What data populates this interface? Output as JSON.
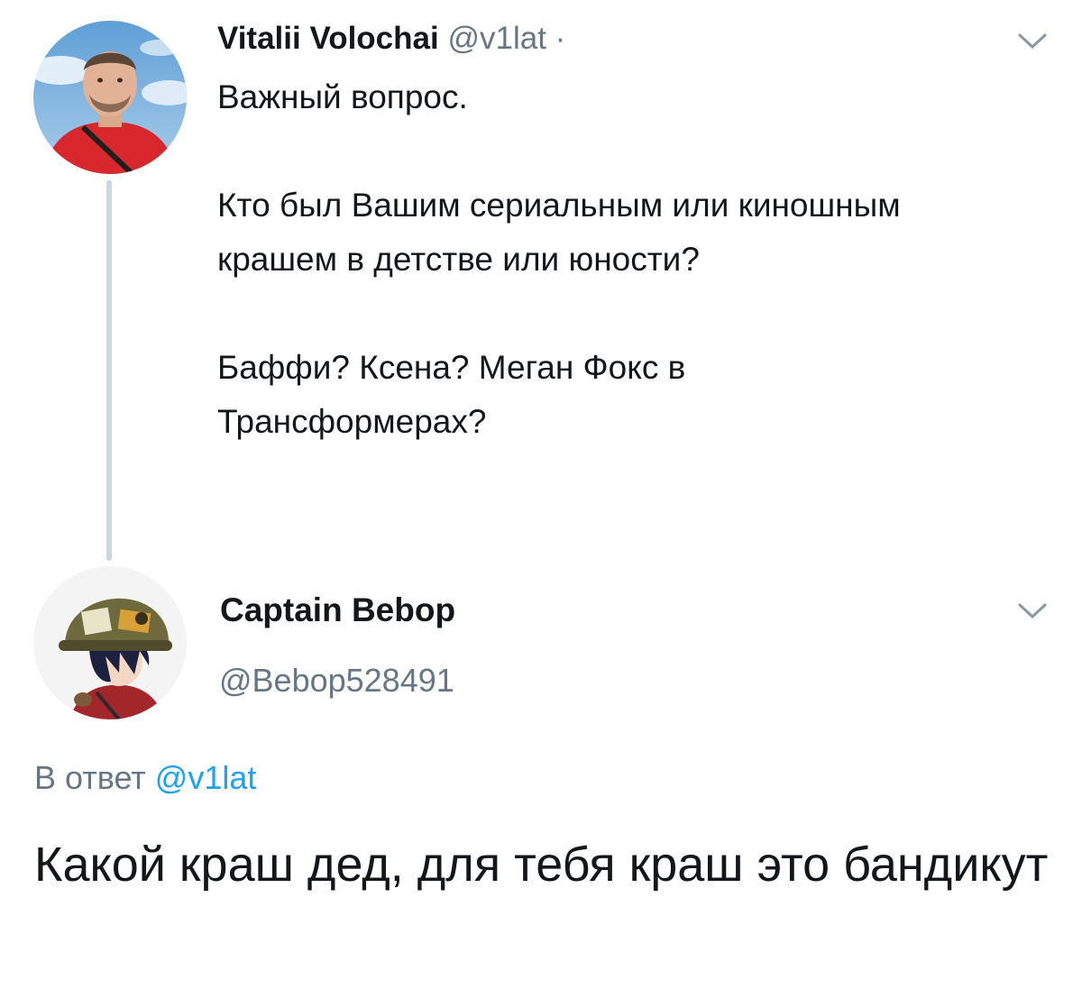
{
  "tweet": {
    "author": {
      "display_name": "Vitalii Volochai",
      "handle": "@v1lat",
      "separator": "·"
    },
    "paragraphs": [
      "Важный вопрос.",
      "Кто был Вашим сериальным или киношным крашем в детстве или юности?",
      "Баффи? Ксена? Меган Фокс в Трансформерах?"
    ],
    "menu_icon": "chevron-down-icon"
  },
  "reply": {
    "author": {
      "display_name": "Captain Bebop",
      "handle": "@Bebop528491"
    },
    "reply_to_prefix": "В ответ",
    "reply_to_handle": "@v1lat",
    "text": "Какой краш дед, для тебя краш это бандикут",
    "menu_icon": "chevron-down-icon"
  },
  "colors": {
    "text": "#14171a",
    "muted": "#657786",
    "mention": "#1da1f2",
    "thread_line": "#ccd6dd"
  }
}
